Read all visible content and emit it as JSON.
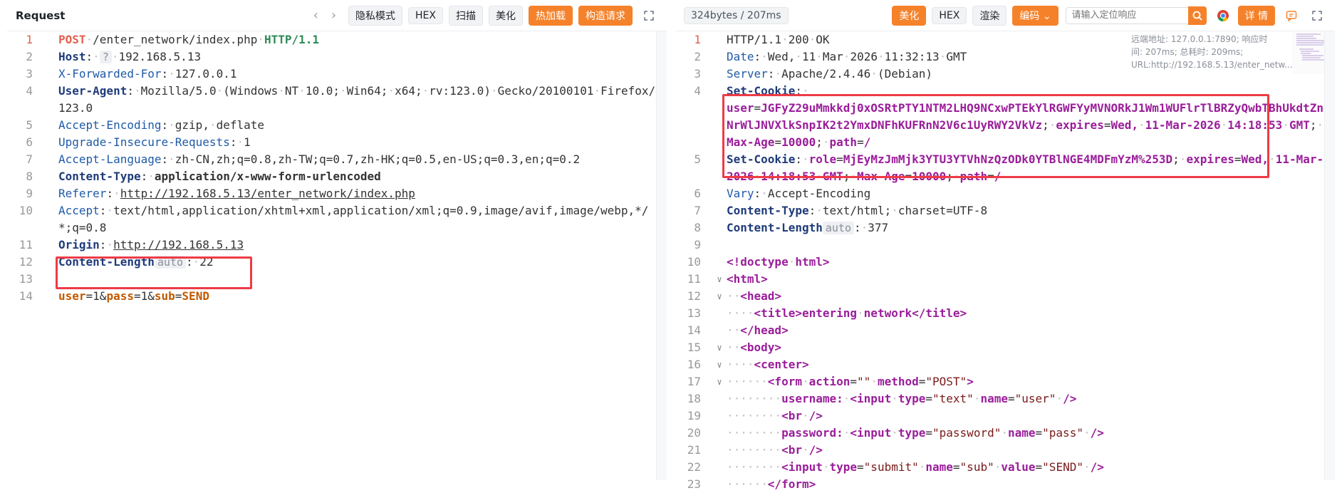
{
  "request": {
    "title": "Request",
    "nav_prev": "‹",
    "nav_next": "›",
    "buttons": [
      "隐私模式",
      "HEX",
      "扫描",
      "美化",
      "热加载",
      "构造请求"
    ],
    "lines": [
      {
        "n": "1",
        "t": "POST /enter_network/index.php HTTP/1.1"
      },
      {
        "n": "2",
        "t": "Host: 192.168.5.13"
      },
      {
        "n": "3",
        "t": "X-Forwarded-For: 127.0.0.1"
      },
      {
        "n": "4",
        "t": "User-Agent: Mozilla/5.0 (Windows NT 10.0; Win64; x64; rv:123.0) Gecko/20100101 Firefox/123.0"
      },
      {
        "n": "5",
        "t": "Accept-Encoding: gzip, deflate"
      },
      {
        "n": "6",
        "t": "Upgrade-Insecure-Requests: 1"
      },
      {
        "n": "7",
        "t": "Accept-Language: zh-CN,zh;q=0.8,zh-TW;q=0.7,zh-HK;q=0.5,en-US;q=0.3,en;q=0.2"
      },
      {
        "n": "8",
        "t": "Content-Type: application/x-www-form-urlencoded"
      },
      {
        "n": "9",
        "t": "Referer: http://192.168.5.13/enter_network/index.php"
      },
      {
        "n": "10",
        "t": "Accept: text/html,application/xhtml+xml,application/xml;q=0.9,image/avif,image/webp,*/*;q=0.8"
      },
      {
        "n": "11",
        "t": "Origin: http://192.168.5.13"
      },
      {
        "n": "12",
        "t": "Content-Length auto : 22"
      },
      {
        "n": "13",
        "t": ""
      },
      {
        "n": "14",
        "t": "user=1&pass=1&sub=SEND"
      }
    ],
    "host_pill": "?",
    "cl_pill": "auto"
  },
  "response": {
    "size_badge": "324bytes / 207ms",
    "buttons": [
      "美化",
      "HEX",
      "渲染",
      "编码"
    ],
    "search_placeholder": "请输入定位响应",
    "detail_button": "详 情",
    "meta": "远端地址: 127.0.0.1:7890; 响应时间: 207ms; 总耗时: 209ms; URL:http://192.168.5.13/enter_netw...",
    "lines": [
      {
        "n": "1",
        "t": "HTTP/1.1 200 OK"
      },
      {
        "n": "2",
        "t": "Date: Wed, 11 Mar 2026 11:32:13 GMT"
      },
      {
        "n": "3",
        "t": "Server: Apache/2.4.46 (Debian)"
      },
      {
        "n": "4",
        "t": "Set-Cookie:"
      },
      {
        "n": "",
        "t": "user=JGFyZ29uMmkkdj0xOSRtPTY1NTM2LHQ9NCxwPTEkYlRGWFYyMVNORkJ1Wm1WUFlrTlBRZyQwbTBhUkdtZnNrWlJNVXlkSnpIK2t2YmxDNFhKUFRnN2V6c1UyRWY2VkVz; expires=Wed, 11-Mar-2026 14:18:53 GMT; Max-Age=10000; path=/"
      },
      {
        "n": "5",
        "t": "Set-Cookie: role=MjEyMzJmMjk3YTU3YTVhNzQzODk0YTBlNGE4MDFmYzM%253D; expires=Wed, 11-Mar-2026 14:18:53 GMT; Max-Age=10000; path=/"
      },
      {
        "n": "6",
        "t": "Vary: Accept-Encoding"
      },
      {
        "n": "7",
        "t": "Content-Type: text/html; charset=UTF-8"
      },
      {
        "n": "8",
        "t": "Content-Length auto : 377"
      },
      {
        "n": "9",
        "t": ""
      },
      {
        "n": "10",
        "t": "<!doctype html>"
      },
      {
        "n": "11",
        "t": "<html>"
      },
      {
        "n": "12",
        "t": "<head>"
      },
      {
        "n": "13",
        "t": "<title>entering network</title>"
      },
      {
        "n": "14",
        "t": "</head>"
      },
      {
        "n": "15",
        "t": "<body>"
      },
      {
        "n": "16",
        "t": "<center>"
      },
      {
        "n": "17",
        "t": "<form action=\"\" method=\"POST\">"
      },
      {
        "n": "18",
        "t": "username: <input type=\"text\" name=\"user\" />"
      },
      {
        "n": "19",
        "t": "<br />"
      },
      {
        "n": "20",
        "t": "password: <input type=\"password\" name=\"pass\" />"
      },
      {
        "n": "21",
        "t": "<br />"
      },
      {
        "n": "22",
        "t": "<input type=\"submit\" name=\"sub\" value=\"SEND\" />"
      },
      {
        "n": "23",
        "t": "</form>"
      }
    ]
  }
}
